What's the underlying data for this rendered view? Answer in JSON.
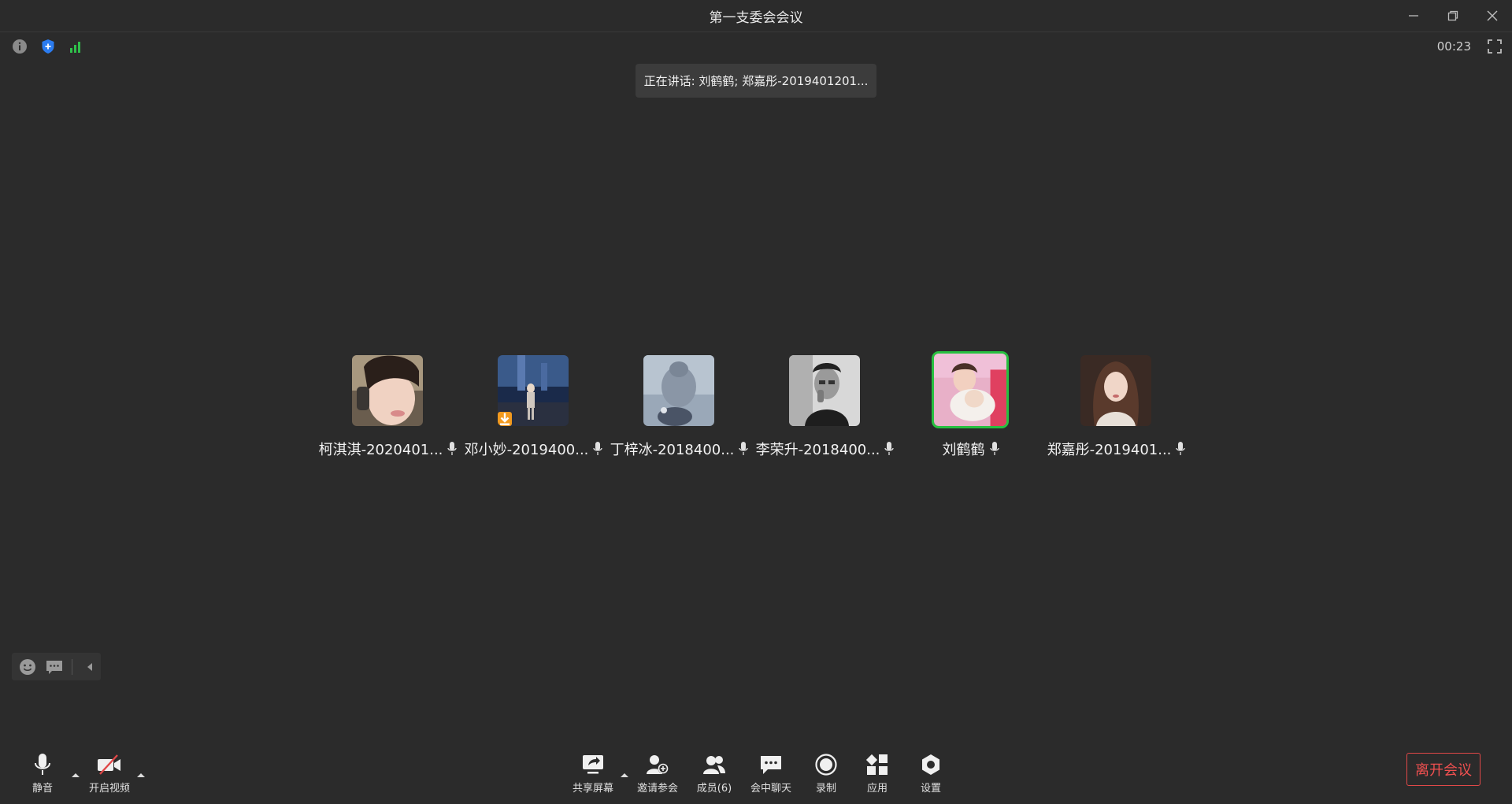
{
  "window": {
    "title": "第一支委会会议"
  },
  "status": {
    "timer": "00:23",
    "speaking": "正在讲话: 刘鹤鹤; 郑嘉彤-2019401201..."
  },
  "participants": [
    {
      "name": "柯淇淇-2020401...",
      "active": false
    },
    {
      "name": "邓小妙-2019400...",
      "active": false
    },
    {
      "name": "丁梓冰-2018400...",
      "active": false
    },
    {
      "name": "李荣升-2018400...",
      "active": false
    },
    {
      "name": "刘鹤鹤",
      "active": true
    },
    {
      "name": "郑嘉彤-2019401...",
      "active": false
    }
  ],
  "toolbar": {
    "mute": "静音",
    "video": "开启视频",
    "share": "共享屏幕",
    "invite": "邀请参会",
    "members": "成员(6)",
    "chat": "会中聊天",
    "record": "录制",
    "apps": "应用",
    "settings": "设置",
    "leave": "离开会议"
  },
  "colors": {
    "background": "#2b2b2b",
    "active_speaker": "#28c040",
    "leave": "#f05050",
    "security": "#2b7cf0",
    "signal": "#2fbf4a"
  }
}
